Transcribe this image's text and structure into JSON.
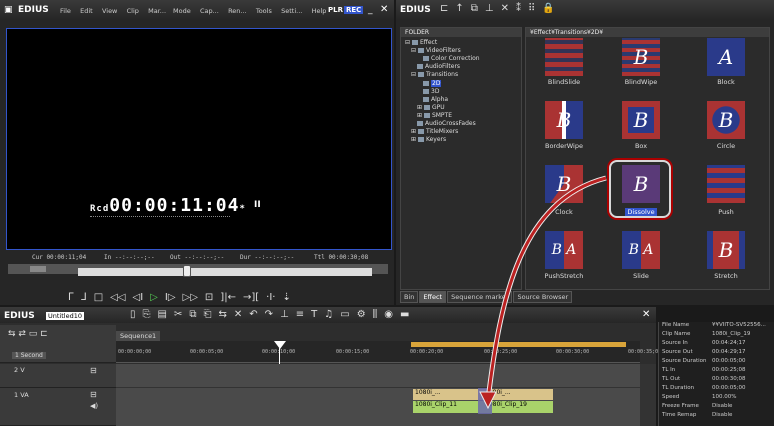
{
  "player": {
    "app_name": "EDIUS",
    "menu": [
      "File",
      "Edit",
      "View",
      "Clip",
      "Mar...",
      "Mode",
      "Cap...",
      "Ren...",
      "Tools",
      "Setti...",
      "Help"
    ],
    "plr": "PLR",
    "rec": "REC",
    "rcd_prefix": "Rcd",
    "timecode": "00:00:11:04",
    "tc_star": "*",
    "pause_symbol": "II",
    "cur": "Cur 00:00:11;04",
    "in": "In --:--:--;--",
    "out": "Out --:--:--;--",
    "dur": "Dur --:--:--;--",
    "ttl": "Ttl 00:00:30;08"
  },
  "effect": {
    "app_name": "EDIUS",
    "folder_header": "FOLDER",
    "path_header": "¥Effect¥Transitions¥2D¥",
    "tree": [
      "Effect",
      "VideoFilters",
      "Color Correction",
      "AudioFilters",
      "Transitions",
      "2D",
      "3D",
      "Alpha",
      "GPU",
      "SMPTE",
      "AudioCrossFades",
      "TitleMixers",
      "Keyers"
    ],
    "tiles": [
      {
        "label": "BlindSlide",
        "glyph": ""
      },
      {
        "label": "BlindWipe",
        "glyph": "B"
      },
      {
        "label": "Block",
        "glyph": "A"
      },
      {
        "label": "BorderWipe",
        "glyph": "B"
      },
      {
        "label": "Box",
        "glyph": "B"
      },
      {
        "label": "Circle",
        "glyph": "B"
      },
      {
        "label": "Clock",
        "glyph": "B"
      },
      {
        "label": "Dissolve",
        "glyph": "B"
      },
      {
        "label": "Push",
        "glyph": ""
      },
      {
        "label": "PushStretch",
        "glyph": "B A"
      },
      {
        "label": "Slide",
        "glyph": "B A"
      },
      {
        "label": "Stretch",
        "glyph": "B"
      }
    ],
    "tabs": [
      "Bin",
      "Effect",
      "Sequence marker",
      "Source Browser"
    ]
  },
  "timeline": {
    "app_name": "EDIUS",
    "project": "Untitled10",
    "sequence_tab": "Sequence1",
    "scale": "1 Second",
    "ruler": [
      "00:00:00;00",
      "00:00:05;00",
      "00:00:10;00",
      "00:00:15;00",
      "00:00:20;00",
      "00:00:25;00",
      "00:00:30;00",
      "00:00:35;00"
    ],
    "track_2v": "2 V",
    "track_1va": "1 VA",
    "clips": {
      "v1_left": "1080i_...",
      "v1_right": "1080i_...",
      "a1_left": "1080i_Clip_11",
      "a1_right": "1080i_Clip_19"
    }
  },
  "props": [
    {
      "k": "File Name",
      "v": "¥¥VIITO-SV52556..."
    },
    {
      "k": "Clip Name",
      "v": "1080i_Clip_19"
    },
    {
      "k": "Source In",
      "v": "00:04:24;17"
    },
    {
      "k": "Source Out",
      "v": "00:04:29;17"
    },
    {
      "k": "Source Duration",
      "v": "00:00:05;00"
    },
    {
      "k": "TL In",
      "v": "00:00:25;08"
    },
    {
      "k": "TL Out",
      "v": "00:00:30;08"
    },
    {
      "k": "TL Duration",
      "v": "00:00:05;00"
    },
    {
      "k": "Speed",
      "v": "100.00%"
    },
    {
      "k": "Freeze Frame",
      "v": "Disable"
    },
    {
      "k": "Time Remap",
      "v": "Disable"
    }
  ]
}
